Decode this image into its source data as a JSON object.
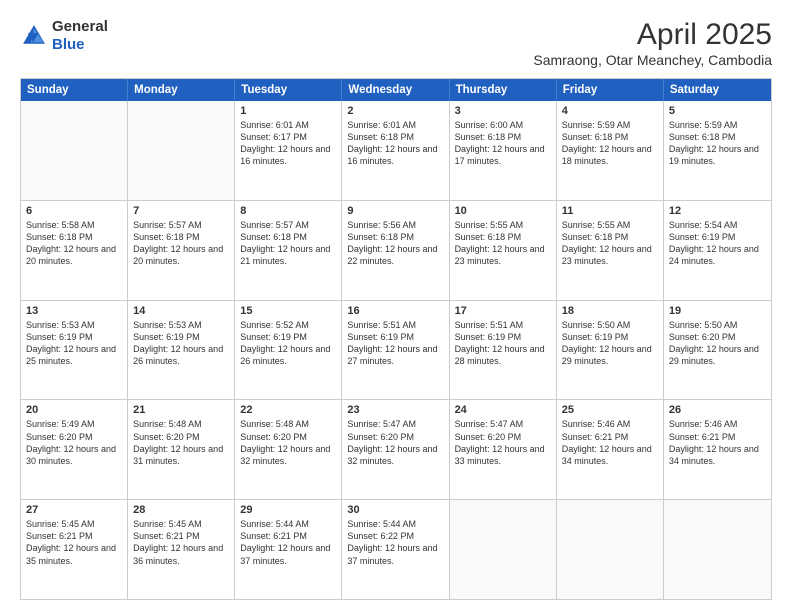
{
  "logo": {
    "general": "General",
    "blue": "Blue"
  },
  "title": "April 2025",
  "subtitle": "Samraong, Otar Meanchey, Cambodia",
  "days": [
    "Sunday",
    "Monday",
    "Tuesday",
    "Wednesday",
    "Thursday",
    "Friday",
    "Saturday"
  ],
  "weeks": [
    [
      {
        "date": "",
        "info": ""
      },
      {
        "date": "",
        "info": ""
      },
      {
        "date": "1",
        "info": "Sunrise: 6:01 AM\nSunset: 6:17 PM\nDaylight: 12 hours and 16 minutes."
      },
      {
        "date": "2",
        "info": "Sunrise: 6:01 AM\nSunset: 6:18 PM\nDaylight: 12 hours and 16 minutes."
      },
      {
        "date": "3",
        "info": "Sunrise: 6:00 AM\nSunset: 6:18 PM\nDaylight: 12 hours and 17 minutes."
      },
      {
        "date": "4",
        "info": "Sunrise: 5:59 AM\nSunset: 6:18 PM\nDaylight: 12 hours and 18 minutes."
      },
      {
        "date": "5",
        "info": "Sunrise: 5:59 AM\nSunset: 6:18 PM\nDaylight: 12 hours and 19 minutes."
      }
    ],
    [
      {
        "date": "6",
        "info": "Sunrise: 5:58 AM\nSunset: 6:18 PM\nDaylight: 12 hours and 20 minutes."
      },
      {
        "date": "7",
        "info": "Sunrise: 5:57 AM\nSunset: 6:18 PM\nDaylight: 12 hours and 20 minutes."
      },
      {
        "date": "8",
        "info": "Sunrise: 5:57 AM\nSunset: 6:18 PM\nDaylight: 12 hours and 21 minutes."
      },
      {
        "date": "9",
        "info": "Sunrise: 5:56 AM\nSunset: 6:18 PM\nDaylight: 12 hours and 22 minutes."
      },
      {
        "date": "10",
        "info": "Sunrise: 5:55 AM\nSunset: 6:18 PM\nDaylight: 12 hours and 23 minutes."
      },
      {
        "date": "11",
        "info": "Sunrise: 5:55 AM\nSunset: 6:18 PM\nDaylight: 12 hours and 23 minutes."
      },
      {
        "date": "12",
        "info": "Sunrise: 5:54 AM\nSunset: 6:19 PM\nDaylight: 12 hours and 24 minutes."
      }
    ],
    [
      {
        "date": "13",
        "info": "Sunrise: 5:53 AM\nSunset: 6:19 PM\nDaylight: 12 hours and 25 minutes."
      },
      {
        "date": "14",
        "info": "Sunrise: 5:53 AM\nSunset: 6:19 PM\nDaylight: 12 hours and 26 minutes."
      },
      {
        "date": "15",
        "info": "Sunrise: 5:52 AM\nSunset: 6:19 PM\nDaylight: 12 hours and 26 minutes."
      },
      {
        "date": "16",
        "info": "Sunrise: 5:51 AM\nSunset: 6:19 PM\nDaylight: 12 hours and 27 minutes."
      },
      {
        "date": "17",
        "info": "Sunrise: 5:51 AM\nSunset: 6:19 PM\nDaylight: 12 hours and 28 minutes."
      },
      {
        "date": "18",
        "info": "Sunrise: 5:50 AM\nSunset: 6:19 PM\nDaylight: 12 hours and 29 minutes."
      },
      {
        "date": "19",
        "info": "Sunrise: 5:50 AM\nSunset: 6:20 PM\nDaylight: 12 hours and 29 minutes."
      }
    ],
    [
      {
        "date": "20",
        "info": "Sunrise: 5:49 AM\nSunset: 6:20 PM\nDaylight: 12 hours and 30 minutes."
      },
      {
        "date": "21",
        "info": "Sunrise: 5:48 AM\nSunset: 6:20 PM\nDaylight: 12 hours and 31 minutes."
      },
      {
        "date": "22",
        "info": "Sunrise: 5:48 AM\nSunset: 6:20 PM\nDaylight: 12 hours and 32 minutes."
      },
      {
        "date": "23",
        "info": "Sunrise: 5:47 AM\nSunset: 6:20 PM\nDaylight: 12 hours and 32 minutes."
      },
      {
        "date": "24",
        "info": "Sunrise: 5:47 AM\nSunset: 6:20 PM\nDaylight: 12 hours and 33 minutes."
      },
      {
        "date": "25",
        "info": "Sunrise: 5:46 AM\nSunset: 6:21 PM\nDaylight: 12 hours and 34 minutes."
      },
      {
        "date": "26",
        "info": "Sunrise: 5:46 AM\nSunset: 6:21 PM\nDaylight: 12 hours and 34 minutes."
      }
    ],
    [
      {
        "date": "27",
        "info": "Sunrise: 5:45 AM\nSunset: 6:21 PM\nDaylight: 12 hours and 35 minutes."
      },
      {
        "date": "28",
        "info": "Sunrise: 5:45 AM\nSunset: 6:21 PM\nDaylight: 12 hours and 36 minutes."
      },
      {
        "date": "29",
        "info": "Sunrise: 5:44 AM\nSunset: 6:21 PM\nDaylight: 12 hours and 37 minutes."
      },
      {
        "date": "30",
        "info": "Sunrise: 5:44 AM\nSunset: 6:22 PM\nDaylight: 12 hours and 37 minutes."
      },
      {
        "date": "",
        "info": ""
      },
      {
        "date": "",
        "info": ""
      },
      {
        "date": "",
        "info": ""
      }
    ]
  ]
}
